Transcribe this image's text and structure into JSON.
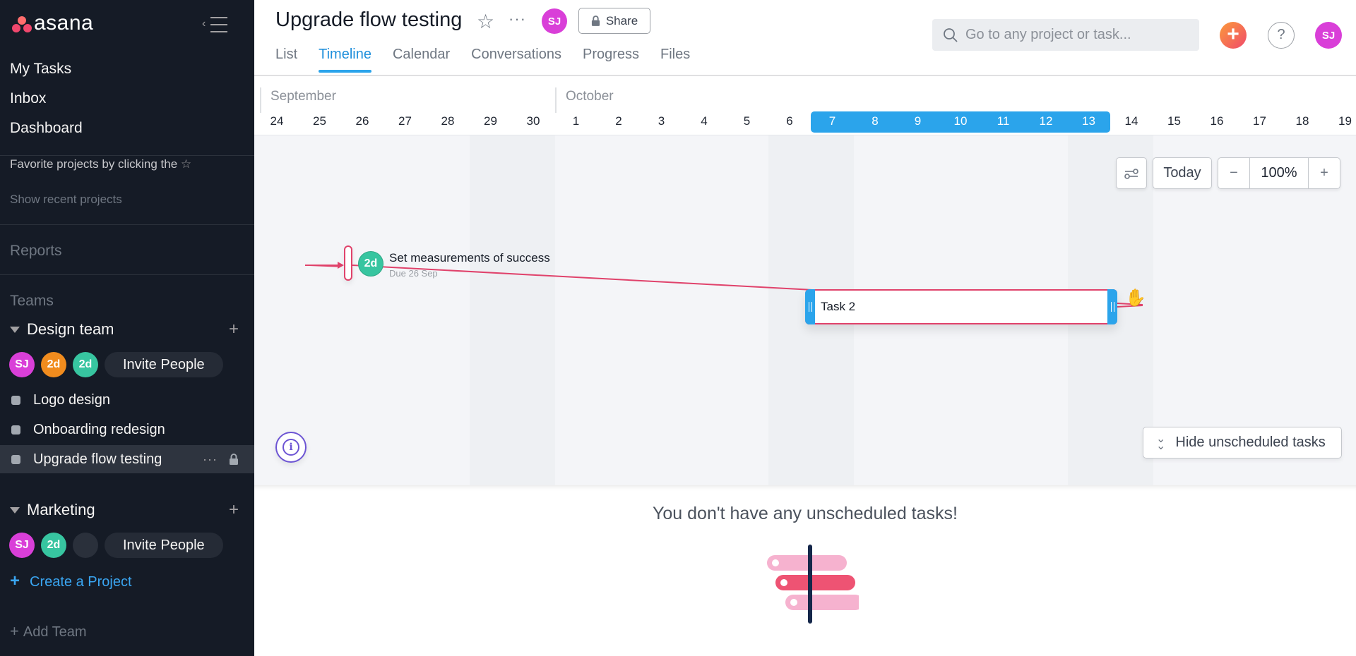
{
  "sidebar": {
    "logo_text": "asana",
    "collapse_icon": "collapse-sidebar-icon",
    "nav": [
      "My Tasks",
      "Inbox",
      "Dashboard"
    ],
    "favorites_hint": "Favorite projects by clicking the",
    "show_recent": "Show recent projects",
    "reports_label": "Reports",
    "teams_label": "Teams",
    "teams": [
      {
        "name": "Design team",
        "members": [
          {
            "initials": "SJ",
            "color": "#d93fd8"
          },
          {
            "initials": "2d",
            "color": "#f18c1e"
          },
          {
            "initials": "2d",
            "color": "#37c5a0"
          }
        ],
        "invite_label": "Invite People",
        "projects": [
          "Logo design",
          "Onboarding redesign",
          "Upgrade flow testing"
        ],
        "active_project": "Upgrade flow testing"
      },
      {
        "name": "Marketing",
        "members": [
          {
            "initials": "SJ",
            "color": "#d93fd8"
          },
          {
            "initials": "2d",
            "color": "#37c5a0"
          },
          {
            "initials": "",
            "color": "#2a303b"
          }
        ],
        "invite_label": "Invite People",
        "projects": []
      }
    ],
    "create_project": "Create a Project",
    "add_team": "Add Team"
  },
  "header": {
    "project_title": "Upgrade flow testing",
    "owner_initials": "SJ",
    "share_label": "Share",
    "tabs": [
      "List",
      "Timeline",
      "Calendar",
      "Conversations",
      "Progress",
      "Files"
    ],
    "active_tab": "Timeline",
    "search_placeholder": "Go to any project or task...",
    "help_label": "?",
    "user_initials": "SJ",
    "accent_color": "#2ba4eb"
  },
  "timeline": {
    "months": [
      "September",
      "October"
    ],
    "days": [
      "24",
      "25",
      "26",
      "27",
      "28",
      "29",
      "30",
      "1",
      "2",
      "3",
      "4",
      "5",
      "6",
      "7",
      "8",
      "9",
      "10",
      "11",
      "12",
      "13",
      "14",
      "15",
      "16",
      "17",
      "18",
      "19"
    ],
    "highlighted_days": [
      "7",
      "8",
      "9",
      "10",
      "11",
      "12",
      "13"
    ],
    "controls": {
      "today_label": "Today",
      "zoom_out": "−",
      "zoom_level": "100%",
      "zoom_in": "+"
    },
    "tasks": [
      {
        "name": "Set measurements of success",
        "assignee": "2d",
        "due": "Due 26 Sep",
        "type": "milestone"
      },
      {
        "name": "Task 2",
        "start": "7 Oct",
        "end": "13 Oct",
        "type": "bar"
      }
    ],
    "hide_unscheduled_label": "Hide unscheduled tasks",
    "dependency_color": "#e0426b"
  },
  "unscheduled": {
    "empty_message": "You don't have any unscheduled tasks!"
  }
}
